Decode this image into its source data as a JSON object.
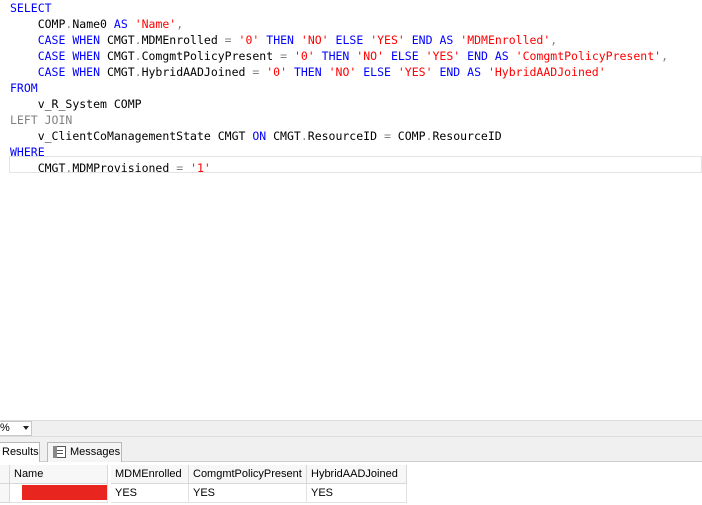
{
  "editor": {
    "lines": [
      [
        {
          "t": "SELECT",
          "c": "kw"
        }
      ],
      [
        {
          "t": "    ",
          "c": "txt"
        },
        {
          "t": "COMP",
          "c": "txt"
        },
        {
          "t": ".",
          "c": "gray"
        },
        {
          "t": "Name0 ",
          "c": "txt"
        },
        {
          "t": "AS",
          "c": "kw"
        },
        {
          "t": " ",
          "c": "txt"
        },
        {
          "t": "'Name'",
          "c": "str"
        },
        {
          "t": ",",
          "c": "gray"
        }
      ],
      [
        {
          "t": "    ",
          "c": "txt"
        },
        {
          "t": "CASE WHEN",
          "c": "kw"
        },
        {
          "t": " CMGT",
          "c": "txt"
        },
        {
          "t": ".",
          "c": "gray"
        },
        {
          "t": "MDMEnrolled ",
          "c": "txt"
        },
        {
          "t": "=",
          "c": "gray"
        },
        {
          "t": " ",
          "c": "txt"
        },
        {
          "t": "'0'",
          "c": "str"
        },
        {
          "t": " ",
          "c": "txt"
        },
        {
          "t": "THEN",
          "c": "kw"
        },
        {
          "t": " ",
          "c": "txt"
        },
        {
          "t": "'NO'",
          "c": "str"
        },
        {
          "t": " ",
          "c": "txt"
        },
        {
          "t": "ELSE",
          "c": "kw"
        },
        {
          "t": " ",
          "c": "txt"
        },
        {
          "t": "'YES'",
          "c": "str"
        },
        {
          "t": " ",
          "c": "txt"
        },
        {
          "t": "END",
          "c": "kw"
        },
        {
          "t": " ",
          "c": "txt"
        },
        {
          "t": "AS",
          "c": "kw"
        },
        {
          "t": " ",
          "c": "txt"
        },
        {
          "t": "'MDMEnrolled'",
          "c": "str"
        },
        {
          "t": ",",
          "c": "gray"
        }
      ],
      [
        {
          "t": "    ",
          "c": "txt"
        },
        {
          "t": "CASE WHEN",
          "c": "kw"
        },
        {
          "t": " CMGT",
          "c": "txt"
        },
        {
          "t": ".",
          "c": "gray"
        },
        {
          "t": "ComgmtPolicyPresent ",
          "c": "txt"
        },
        {
          "t": "=",
          "c": "gray"
        },
        {
          "t": " ",
          "c": "txt"
        },
        {
          "t": "'0'",
          "c": "str"
        },
        {
          "t": " ",
          "c": "txt"
        },
        {
          "t": "THEN",
          "c": "kw"
        },
        {
          "t": " ",
          "c": "txt"
        },
        {
          "t": "'NO'",
          "c": "str"
        },
        {
          "t": " ",
          "c": "txt"
        },
        {
          "t": "ELSE",
          "c": "kw"
        },
        {
          "t": " ",
          "c": "txt"
        },
        {
          "t": "'YES'",
          "c": "str"
        },
        {
          "t": " ",
          "c": "txt"
        },
        {
          "t": "END",
          "c": "kw"
        },
        {
          "t": " ",
          "c": "txt"
        },
        {
          "t": "AS",
          "c": "kw"
        },
        {
          "t": " ",
          "c": "txt"
        },
        {
          "t": "'ComgmtPolicyPresent'",
          "c": "str"
        },
        {
          "t": ",",
          "c": "gray"
        }
      ],
      [
        {
          "t": "    ",
          "c": "txt"
        },
        {
          "t": "CASE WHEN",
          "c": "kw"
        },
        {
          "t": " CMGT",
          "c": "txt"
        },
        {
          "t": ".",
          "c": "gray"
        },
        {
          "t": "HybridAADJoined ",
          "c": "txt"
        },
        {
          "t": "=",
          "c": "gray"
        },
        {
          "t": " ",
          "c": "txt"
        },
        {
          "t": "'0'",
          "c": "str"
        },
        {
          "t": " ",
          "c": "txt"
        },
        {
          "t": "THEN",
          "c": "kw"
        },
        {
          "t": " ",
          "c": "txt"
        },
        {
          "t": "'NO'",
          "c": "str"
        },
        {
          "t": " ",
          "c": "txt"
        },
        {
          "t": "ELSE",
          "c": "kw"
        },
        {
          "t": " ",
          "c": "txt"
        },
        {
          "t": "'YES'",
          "c": "str"
        },
        {
          "t": " ",
          "c": "txt"
        },
        {
          "t": "END",
          "c": "kw"
        },
        {
          "t": " ",
          "c": "txt"
        },
        {
          "t": "AS",
          "c": "kw"
        },
        {
          "t": " ",
          "c": "txt"
        },
        {
          "t": "'HybridAADJoined'",
          "c": "str"
        }
      ],
      [
        {
          "t": "FROM",
          "c": "kw"
        }
      ],
      [
        {
          "t": "    ",
          "c": "txt"
        },
        {
          "t": "v_R_System COMP",
          "c": "txt"
        }
      ],
      [
        {
          "t": "LEFT JOIN",
          "c": "gray"
        }
      ],
      [
        {
          "t": "    ",
          "c": "txt"
        },
        {
          "t": "v_ClientCoManagementState CMGT ",
          "c": "txt"
        },
        {
          "t": "ON",
          "c": "kw"
        },
        {
          "t": " CMGT",
          "c": "txt"
        },
        {
          "t": ".",
          "c": "gray"
        },
        {
          "t": "ResourceID ",
          "c": "txt"
        },
        {
          "t": "=",
          "c": "gray"
        },
        {
          "t": " COMP",
          "c": "txt"
        },
        {
          "t": ".",
          "c": "gray"
        },
        {
          "t": "ResourceID",
          "c": "txt"
        }
      ],
      [
        {
          "t": "WHERE",
          "c": "kw"
        }
      ],
      [
        {
          "t": "    ",
          "c": "txt"
        },
        {
          "t": "CMGT",
          "c": "txt"
        },
        {
          "t": ".",
          "c": "gray"
        },
        {
          "t": "MDMProvisioned ",
          "c": "txt"
        },
        {
          "t": "=",
          "c": "gray"
        },
        {
          "t": " ",
          "c": "txt"
        },
        {
          "t": "'1'",
          "c": "str"
        }
      ]
    ]
  },
  "zoom": {
    "value": "%"
  },
  "tabs": {
    "results": "Results",
    "messages": "Messages"
  },
  "grid": {
    "headers": [
      "Name",
      "MDMEnrolled",
      "ComgmtPolicyPresent",
      "HybridAADJoined"
    ],
    "rows": [
      {
        "name": "",
        "mdm_enrolled": "YES",
        "comgmt_policy_present": "YES",
        "hybrid_aad_joined": "YES"
      }
    ]
  },
  "colors": {
    "keyword": "#0000ff",
    "string": "#ff0000",
    "operator": "#808080",
    "redaction": "#e8261f"
  }
}
